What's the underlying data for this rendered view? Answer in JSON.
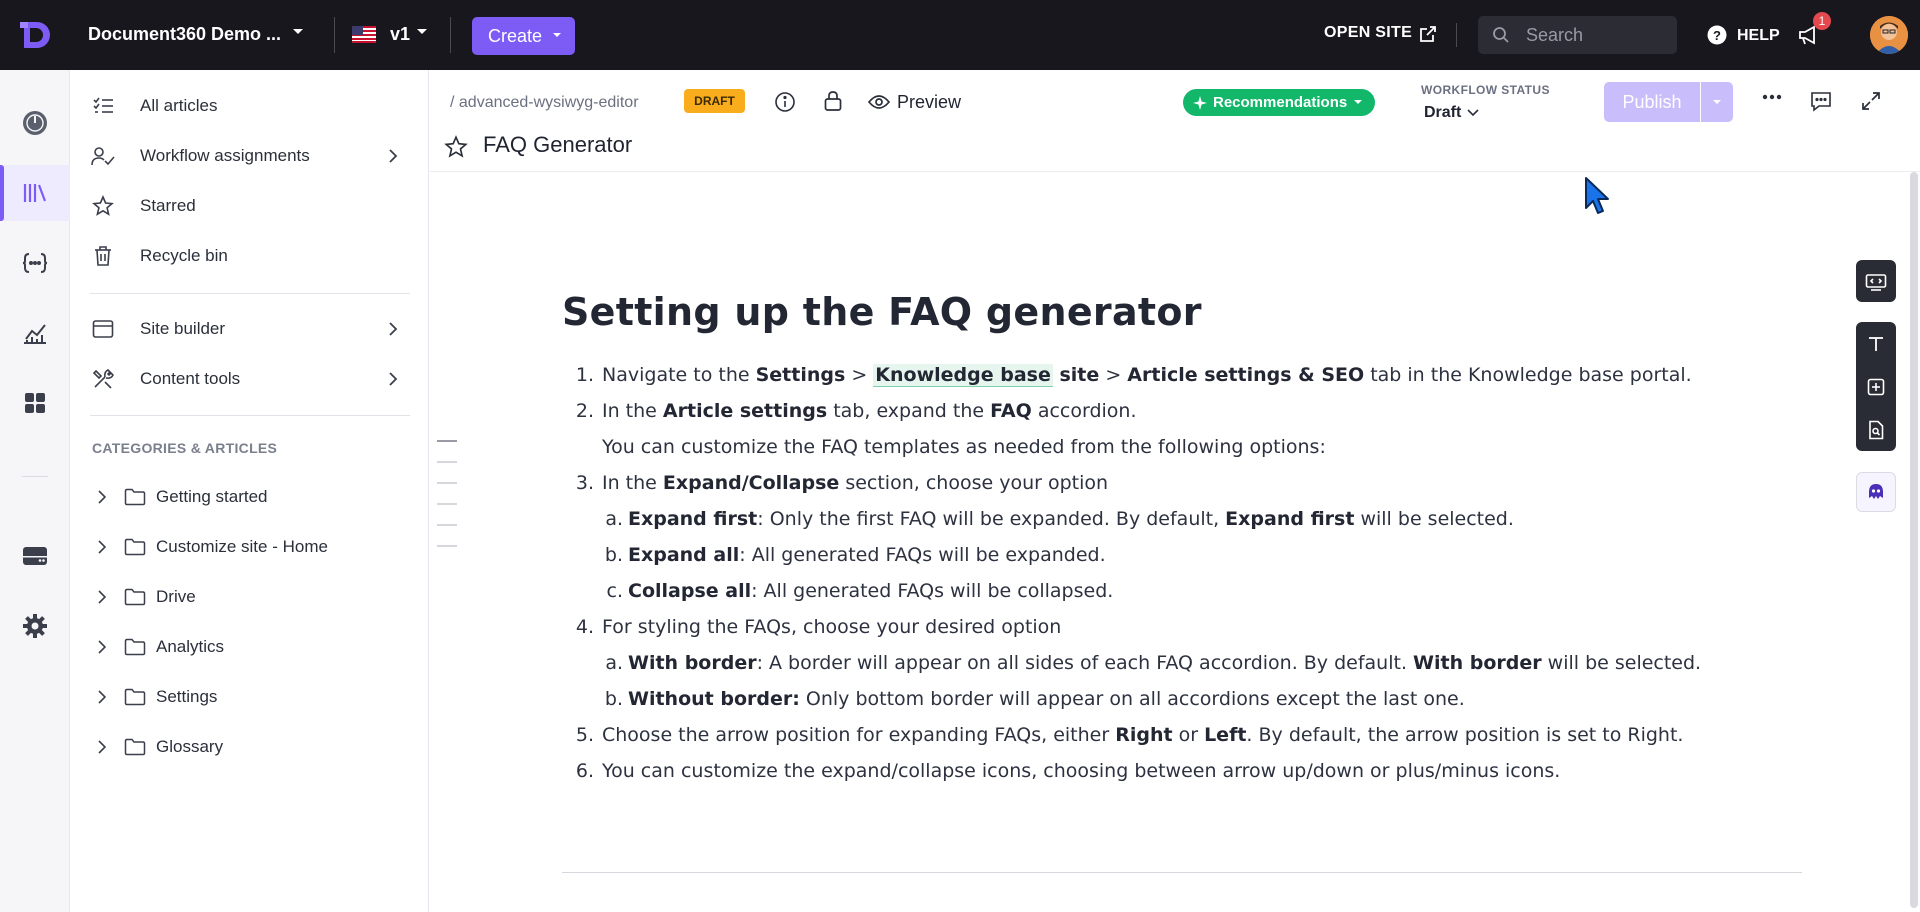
{
  "topbar": {
    "project_name": "Document360 Demo ...",
    "version": "v1",
    "create_label": "Create",
    "open_site_label": "OPEN SITE",
    "search_placeholder": "Search",
    "help_label": "HELP",
    "notification_count": "1"
  },
  "rail": {
    "icons": [
      "dashboard-icon",
      "documentation-icon",
      "api-docs-icon",
      "analytics-icon",
      "apps-icon",
      "drive-icon",
      "settings-icon"
    ],
    "active": "documentation-icon",
    "accent": "#7c5cf5"
  },
  "sidebar": {
    "items": [
      {
        "label": "All articles",
        "icon": "list-check-icon"
      },
      {
        "label": "Workflow assignments",
        "icon": "user-check-icon"
      },
      {
        "label": "Starred",
        "icon": "star-icon"
      },
      {
        "label": "Recycle bin",
        "icon": "trash-icon"
      },
      {
        "label": "Site builder",
        "icon": "browser-icon"
      },
      {
        "label": "Content tools",
        "icon": "tools-icon"
      }
    ],
    "categories_heading": "CATEGORIES & ARTICLES",
    "categories": [
      "Getting started",
      "Customize site - Home",
      "Drive",
      "Analytics",
      "Settings",
      "Glossary"
    ]
  },
  "editor": {
    "slug": "/ advanced-wysiwyg-editor",
    "status_badge": "DRAFT",
    "preview_label": "Preview",
    "recommendations_label": "Recommendations",
    "workflow_status_label": "WORKFLOW STATUS",
    "workflow_status_value": "Draft",
    "publish_label": "Publish",
    "title": "FAQ Generator"
  },
  "article": {
    "heading": "Setting up the FAQ generator",
    "l1": {
      "n": "1.",
      "a": "Navigate to the ",
      "b": "Settings",
      "c": " > ",
      "d": "Knowledge base",
      "e": " site",
      "f": " > ",
      "g": "Article settings & SEO",
      "h": " tab in the Knowledge base portal."
    },
    "l2": {
      "n": "2.",
      "a": "In the ",
      "b": "Article settings",
      "c": " tab, expand the ",
      "d": "FAQ",
      "e": " accordion."
    },
    "l2b": "You can customize the FAQ templates as needed from the following options:",
    "l3": {
      "n": "3.",
      "a": "In the ",
      "b": "Expand/Collapse",
      "c": " section, choose your option"
    },
    "l3a": {
      "n": "a.",
      "b": "Expand first",
      "c": ": Only the first FAQ will be expanded. By default, ",
      "d": "Expand first",
      "e": " will be selected."
    },
    "l3b": {
      "n": "b.",
      "b": "Expand all",
      "c": ": All generated FAQs will be expanded."
    },
    "l3c": {
      "n": "c.",
      "b": "Collapse all",
      "c": ": All generated FAQs will be collapsed."
    },
    "l4": {
      "n": "4.",
      "a": "For styling the FAQs, choose your desired option"
    },
    "l4a": {
      "n": "a.",
      "b": "With border",
      "c": ": A border will appear on all sides of each FAQ accordion. By default. ",
      "d": "With border",
      "e": " will be selected."
    },
    "l4b": {
      "n": "b.",
      "b": "Without border:",
      "c": " Only bottom border will appear on all accordions except the last one."
    },
    "l5": {
      "n": "5.",
      "a": "Choose the arrow position for expanding FAQs, either ",
      "b": "Right",
      "c": " or ",
      "d": "Left",
      "e": ". By default, the arrow position is set to Right."
    },
    "l6": {
      "n": "6.",
      "a": "You can customize the expand/collapse icons, choosing between arrow up/down or plus/minus icons."
    }
  },
  "colors": {
    "topbar_bg": "#17171d",
    "brand": "#7c5cf5",
    "draft_badge": "#f9ad1c",
    "recommendations": "#12b76a",
    "publish_disabled": "#c9bdfb"
  }
}
